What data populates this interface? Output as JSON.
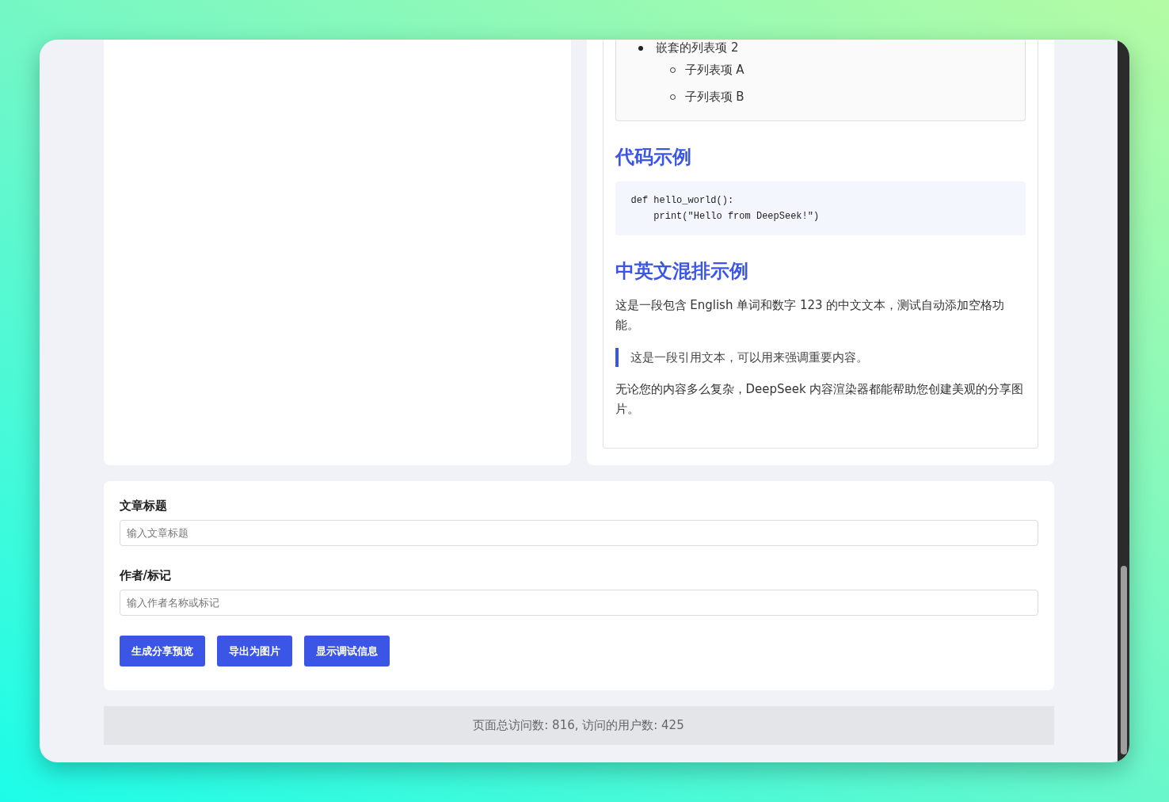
{
  "preview": {
    "nested_list": [
      {
        "text": "嵌套的列表项 2",
        "children": [
          {
            "text": "子列表项 A"
          },
          {
            "text": "子列表项 B"
          }
        ]
      }
    ],
    "blocks": [
      {
        "kind": "heading",
        "text": "代码示例"
      },
      {
        "kind": "code",
        "lines": [
          "def hello_world():",
          "    print(\"Hello from DeepSeek!\")"
        ]
      },
      {
        "kind": "heading",
        "text": "中英文混排示例"
      },
      {
        "kind": "paragraph",
        "text": "这是一段包含 English 单词和数字 123 的中文文本，测试自动添加空格功能。"
      },
      {
        "kind": "quote",
        "text": "这是一段引用文本，可以用来强调重要内容。"
      },
      {
        "kind": "paragraph",
        "text": "无论您的内容多么复杂，DeepSeek 内容渲染器都能帮助您创建美观的分享图片。"
      }
    ]
  },
  "form": {
    "fields": [
      {
        "label": "文章标题",
        "placeholder": "输入文章标题"
      },
      {
        "label": "作者/标记",
        "placeholder": "输入作者名称或标记"
      }
    ],
    "buttons": [
      "生成分享预览",
      "导出为图片",
      "显示调试信息"
    ]
  },
  "footer": "页面总访问数: 816, 访问的用户数: 425"
}
